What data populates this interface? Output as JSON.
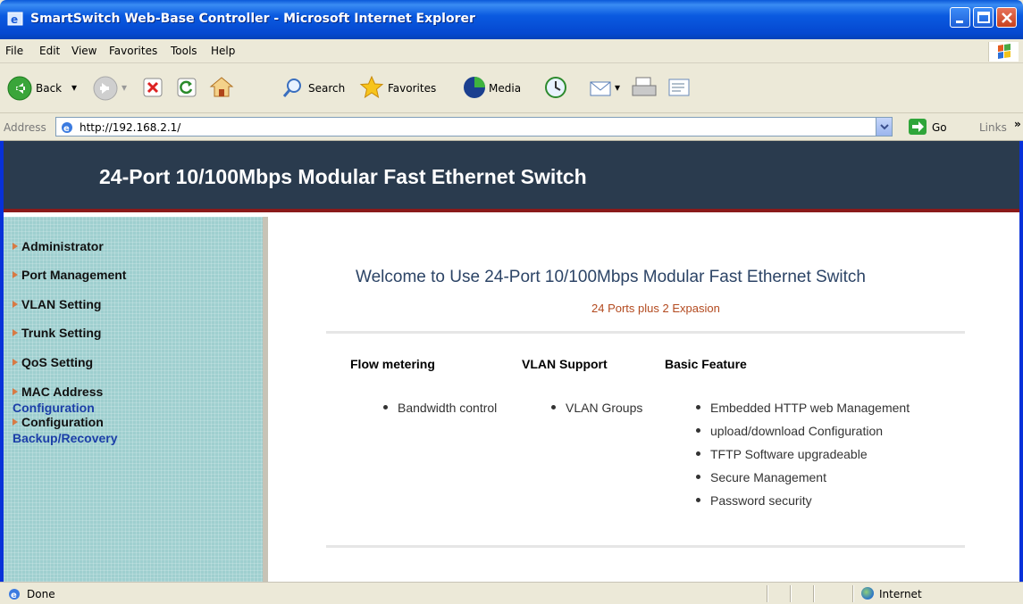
{
  "window": {
    "title": "SmartSwitch Web-Base Controller - Microsoft Internet Explorer"
  },
  "menu": {
    "items": [
      "File",
      "Edit",
      "View",
      "Favorites",
      "Tools",
      "Help"
    ]
  },
  "toolbar": {
    "back_label": "Back",
    "search_label": "Search",
    "favorites_label": "Favorites",
    "media_label": "Media"
  },
  "addressbar": {
    "label": "Address",
    "url": "http://192.168.2.1/",
    "go_label": "Go",
    "links_label": "Links"
  },
  "banner": {
    "heading": "24-Port 10/100Mbps Modular Fast Ethernet Switch"
  },
  "sidebar": {
    "items": [
      {
        "label": "Administrator"
      },
      {
        "label": "Port Management"
      },
      {
        "label": "VLAN Setting"
      },
      {
        "label": "Trunk Setting"
      },
      {
        "label": "QoS Setting"
      },
      {
        "label": "MAC Address",
        "sub": "Configuration"
      },
      {
        "label": "Configuration",
        "sub": "Backup/Recovery"
      }
    ]
  },
  "main": {
    "welcome": "Welcome to Use 24-Port 10/100Mbps Modular Fast Ethernet Switch",
    "subtitle": "24 Ports plus 2 Expasion",
    "columns": [
      {
        "heading": "Flow metering",
        "bullets": [
          "Bandwidth control"
        ]
      },
      {
        "heading": "VLAN Support",
        "bullets": [
          "VLAN Groups"
        ]
      },
      {
        "heading": "Basic Feature",
        "bullets": [
          "Embedded HTTP web Management",
          "upload/download Configuration",
          "TFTP Software upgradeable",
          "Secure Management",
          "Password security"
        ]
      }
    ]
  },
  "status": {
    "text": "Done",
    "zone": "Internet"
  },
  "colors": {
    "banner_bg": "#2a3b4e",
    "banner_border": "#8a1a1a",
    "sidebar_bg": "#9fcfcf",
    "welcome_text": "#2c4466",
    "subtitle_text": "#b34a1f",
    "sidebar_sub_text": "#1c3fa8"
  }
}
